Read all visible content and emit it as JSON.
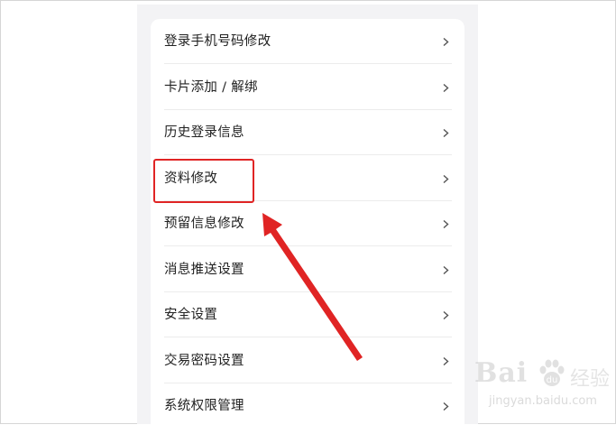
{
  "menu": {
    "items": [
      {
        "label": "登录手机号码修改",
        "icon": "chevron-right-icon"
      },
      {
        "label": "卡片添加 / 解绑",
        "icon": "chevron-right-icon"
      },
      {
        "label": "历史登录信息",
        "icon": "chevron-right-icon"
      },
      {
        "label": "资料修改",
        "icon": "chevron-right-icon"
      },
      {
        "label": "预留信息修改",
        "icon": "chevron-right-icon"
      },
      {
        "label": "消息推送设置",
        "icon": "chevron-right-icon"
      },
      {
        "label": "安全设置",
        "icon": "chevron-right-icon"
      },
      {
        "label": "交易密码设置",
        "icon": "chevron-right-icon"
      },
      {
        "label": "系统权限管理",
        "icon": "chevron-right-icon"
      }
    ]
  },
  "annotation": {
    "highlight_color": "#e02424",
    "highlighted_item": "资料修改",
    "arrow_color": "#e02424"
  },
  "watermark": {
    "brand": "Bai",
    "suffix": "经验",
    "url": "jingyan.baidu.com"
  }
}
